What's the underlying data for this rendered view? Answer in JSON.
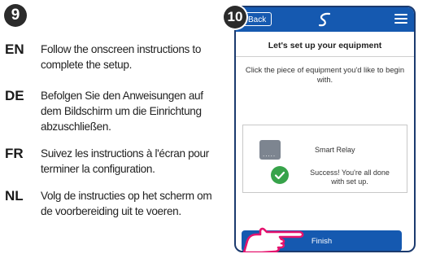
{
  "steps": {
    "left": "9",
    "right": "10"
  },
  "instructions": [
    {
      "code": "EN",
      "text": "Follow the onscreen instructions to complete the setup."
    },
    {
      "code": "DE",
      "text": "Befolgen Sie den Anweisungen auf dem Bildschirm um die Einrichtung abzuschließen."
    },
    {
      "code": "FR",
      "text": "Suivez les instructions à l'écran pour terminer la configuration."
    },
    {
      "code": "NL",
      "text": "Volg de instructies op het scherm om de voorbereiding uit te voeren."
    }
  ],
  "phone": {
    "back_label": "Back",
    "title": "Let's set up your equipment",
    "subtitle": "Click the piece of equipment you'd like to begin with.",
    "device_name": "Smart Relay",
    "success_text": "Success! You're all done with set up.",
    "finish_label": "Finish",
    "colors": {
      "header": "#1559b0",
      "success": "#37a34a",
      "device": "#7d8590",
      "hand": "#e5136e"
    },
    "icons": [
      "menu-icon",
      "brand-logo",
      "checkmark-icon",
      "hand-pointer-icon"
    ]
  }
}
